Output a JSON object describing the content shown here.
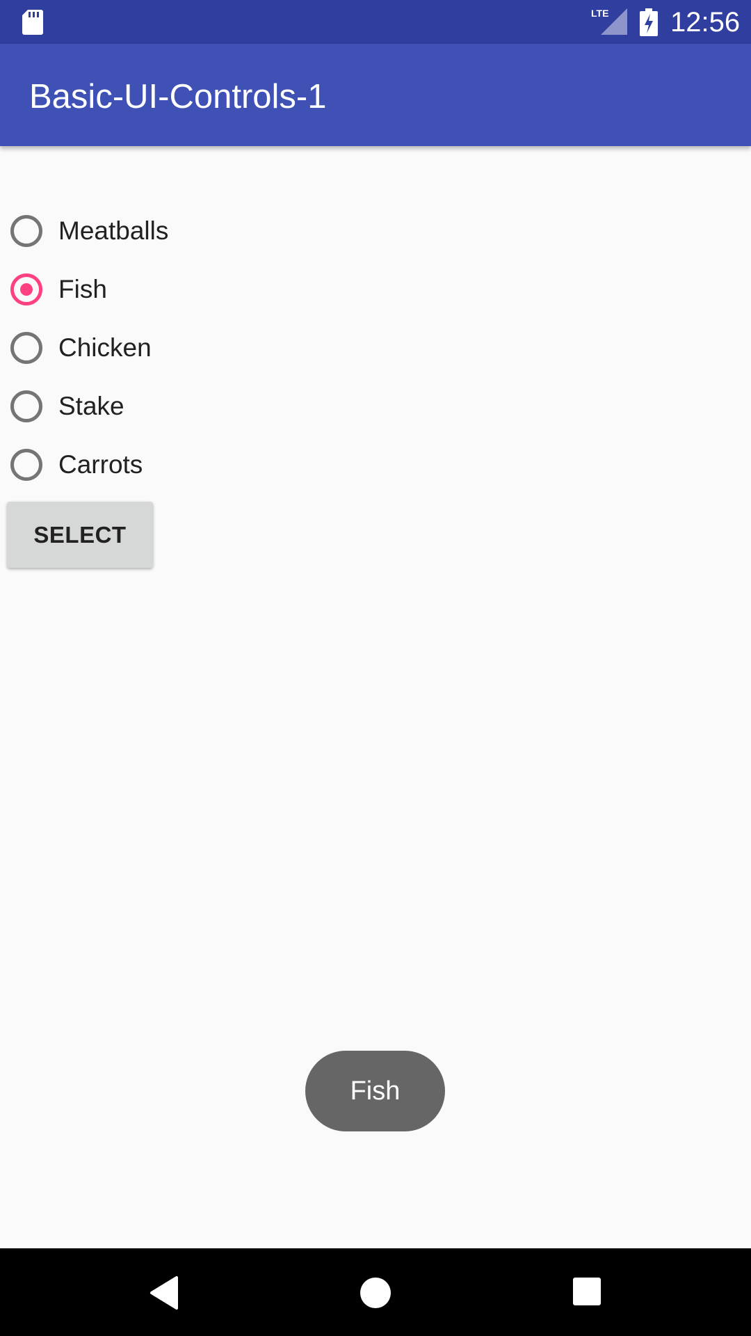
{
  "status_bar": {
    "time": "12:56",
    "network_label": "LTE",
    "icons": [
      "sd-card-icon",
      "lte-signal-icon",
      "battery-charging-icon"
    ],
    "background_color": "#303f9f"
  },
  "app_bar": {
    "title": "Basic-UI-Controls-1",
    "background_color": "#3f51b5"
  },
  "radio_group": {
    "accent_color": "#ff4081",
    "options": [
      {
        "label": "Meatballs",
        "checked": false
      },
      {
        "label": "Fish",
        "checked": true
      },
      {
        "label": "Chicken",
        "checked": false
      },
      {
        "label": "Stake",
        "checked": false
      },
      {
        "label": "Carrots",
        "checked": false
      }
    ]
  },
  "select_button": {
    "label": "SELECT"
  },
  "toast": {
    "message": "Fish"
  },
  "nav_bar": {
    "icons": [
      "back-icon",
      "home-icon",
      "recents-icon"
    ]
  }
}
